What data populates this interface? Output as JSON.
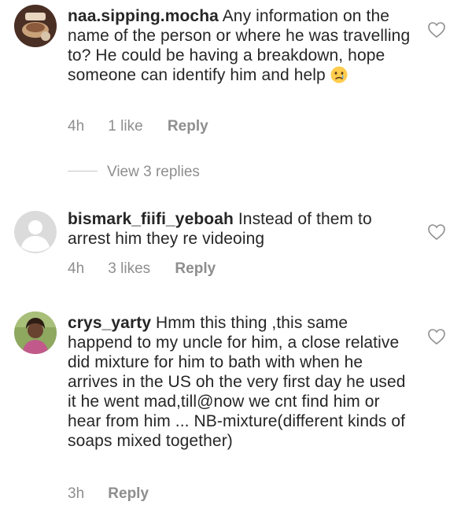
{
  "comments": [
    {
      "username": "naa.sipping.mocha",
      "text": "Any information on the name of the person or where he was travelling to? He could be having a breakdown, hope someone can identify him and help",
      "emoji": "crying-face",
      "time": "4h",
      "likes": "1 like",
      "reply": "Reply",
      "view_replies": "View 3 replies"
    },
    {
      "username": "bismark_fiifi_yeboah",
      "text": "Instead of them to arrest him they re videoing",
      "time": "4h",
      "likes": "3 likes",
      "reply": "Reply"
    },
    {
      "username": "crys_yarty",
      "text": "Hmm this thing ,this same happend to my uncle for him, a close relative did mixture for him to bath with when he arrives in the US oh the very first day he used it he went mad,till@now we cnt find him or hear from him ... NB-mixture(different kinds of soaps mixed together)",
      "time": "3h",
      "reply": "Reply"
    }
  ],
  "icons": {
    "like": "heart-outline-icon",
    "avatar_default": "default-avatar-icon"
  },
  "colors": {
    "text": "#262626",
    "secondary": "#8e8e8e"
  }
}
